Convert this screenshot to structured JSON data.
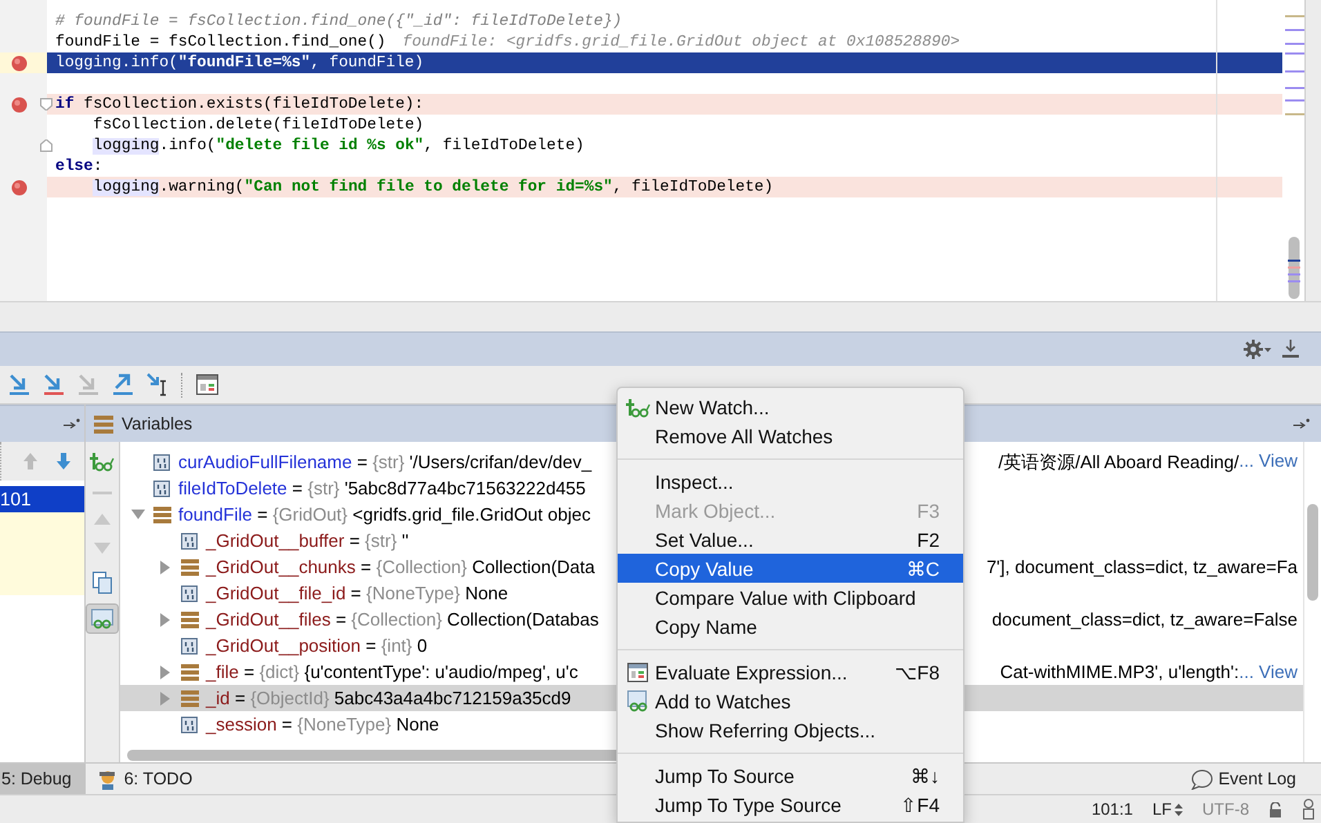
{
  "editor": {
    "lines": [
      {
        "current": false,
        "breakpoint": false,
        "fold_start": false,
        "fold_end": false,
        "tokens": [
          {
            "kind": "comment",
            "text": "# foundFile = fsCollection.find_one({\"_id\": fileIdToDelete})"
          }
        ]
      },
      {
        "current": false,
        "breakpoint": false,
        "fold_start": false,
        "fold_end": false,
        "tokens": [
          {
            "kind": "plain",
            "text": "foundFile = fsCollection.find_one()"
          }
        ],
        "hint": "foundFile: <gridfs.grid_file.GridOut object at 0x108528890>"
      },
      {
        "current": true,
        "breakpoint": true,
        "fold_start": false,
        "fold_end": false,
        "tokens": [
          {
            "kind": "plain",
            "text": "logging.info("
          },
          {
            "kind": "string",
            "text": "\"foundFile=%s\""
          },
          {
            "kind": "plain",
            "text": ", foundFile)"
          }
        ]
      },
      {
        "current": false,
        "breakpoint": true,
        "fold_start": true,
        "fold_end": false,
        "tokens": [
          {
            "kind": "keyword",
            "text": "if"
          },
          {
            "kind": "plain",
            "text": " fsCollection.exists(fileIdToDelete):"
          }
        ],
        "children": [
          {
            "current": false,
            "breakpoint": false,
            "fold_start": false,
            "fold_end": false,
            "tokens": [
              {
                "kind": "plain",
                "text": "fsCollection.delete(fileIdToDelete)"
              }
            ]
          },
          {
            "current": false,
            "breakpoint": false,
            "fold_start": false,
            "fold_end": true,
            "tokens": [
              {
                "kind": "ref",
                "text": "logging"
              },
              {
                "kind": "plain",
                "text": ".info("
              },
              {
                "kind": "string",
                "text": "\"delete file id %s ok\""
              },
              {
                "kind": "plain",
                "text": ", fileIdToDelete)"
              }
            ]
          }
        ]
      },
      {
        "current": false,
        "breakpoint": false,
        "fold_start": false,
        "fold_end": false,
        "tokens": [
          {
            "kind": "keyword",
            "text": "else"
          },
          {
            "kind": "plain",
            "text": ":"
          }
        ],
        "children": [
          {
            "current": false,
            "breakpoint": true,
            "fold_start": false,
            "fold_end": false,
            "tokens": [
              {
                "kind": "ref",
                "text": "logging"
              },
              {
                "kind": "plain",
                "text": ".warning("
              },
              {
                "kind": "string",
                "text": "\"Can not find file to delete for id=%s\""
              },
              {
                "kind": "plain",
                "text": ", fileIdToDelete)"
              }
            ]
          }
        ]
      }
    ]
  },
  "debug_toolbar": {
    "buttons": [
      {
        "disabled": false
      },
      {
        "disabled": false
      },
      {
        "disabled": true
      },
      {
        "disabled": false
      },
      {
        "disabled": false
      },
      {
        "disabled": false
      }
    ]
  },
  "frames": {
    "rows": [
      {
        "label": "101",
        "selected": true
      }
    ]
  },
  "variables": {
    "title": "Variables",
    "rows": [
      {
        "kind": "primitive",
        "name": "curAudioFullFilename",
        "operator": "=",
        "type": "{str}",
        "value": "'/Users/crifan/dev/dev_",
        "value_right": "/英语资源/All Aboard Reading/",
        "link": "... View",
        "expandable": false,
        "selected": false
      },
      {
        "kind": "primitive",
        "name": "fileIdToDelete",
        "operator": "=",
        "type": "{str}",
        "value": "'5abc8d77a4bc71563222d455",
        "expandable": false,
        "selected": false
      },
      {
        "kind": "object",
        "name": "foundFile",
        "operator": "=",
        "type": "{GridOut}",
        "value": "<gridfs.grid_file.GridOut objec",
        "expandable": true,
        "expanded": true,
        "selected": false,
        "children": [
          {
            "kind": "primitive",
            "name": "_GridOut__buffer",
            "operator": "=",
            "type": "{str}",
            "value": "''",
            "expandable": false,
            "selected": false
          },
          {
            "kind": "object",
            "name": "_GridOut__chunks",
            "operator": "=",
            "type": "{Collection}",
            "value": "Collection(Data",
            "value_right": "7'], document_class=dict, tz_aware=Fa",
            "expandable": true,
            "expanded": false,
            "selected": false
          },
          {
            "kind": "primitive",
            "name": "_GridOut__file_id",
            "operator": "=",
            "type": "{NoneType}",
            "value": "None",
            "expandable": false,
            "selected": false
          },
          {
            "kind": "object",
            "name": "_GridOut__files",
            "operator": "=",
            "type": "{Collection}",
            "value": "Collection(Databas",
            "value_right": "document_class=dict, tz_aware=False",
            "expandable": true,
            "expanded": false,
            "selected": false
          },
          {
            "kind": "primitive",
            "name": "_GridOut__position",
            "operator": "=",
            "type": "{int}",
            "value": "0",
            "expandable": false,
            "selected": false
          },
          {
            "kind": "object",
            "name": "_file",
            "operator": "=",
            "type": "{dict}",
            "value": "{u'contentType': u'audio/mpeg', u'c",
            "value_right": "Cat-withMIME.MP3', u'length':",
            "link": "... View",
            "expandable": true,
            "expanded": false,
            "selected": false
          },
          {
            "kind": "object",
            "name": "_id",
            "operator": "=",
            "type": "{ObjectId}",
            "value": "5abc43a4a4bc712159a35cd9",
            "expandable": true,
            "expanded": false,
            "selected": true
          },
          {
            "kind": "primitive",
            "name": "_session",
            "operator": "=",
            "type": "{NoneType}",
            "value": "None",
            "expandable": false,
            "selected": false
          }
        ]
      }
    ]
  },
  "context_menu": {
    "items": [
      {
        "kind": "item",
        "label": "New Watch...",
        "disabled": false,
        "selected": false
      },
      {
        "kind": "item",
        "label": "Remove All Watches",
        "disabled": false,
        "selected": false
      },
      {
        "kind": "separator"
      },
      {
        "kind": "item",
        "label": "Inspect...",
        "disabled": false,
        "selected": false
      },
      {
        "kind": "item",
        "label": "Mark Object...",
        "shortcut": "F3",
        "disabled": true,
        "selected": false
      },
      {
        "kind": "item",
        "label": "Set Value...",
        "shortcut": "F2",
        "disabled": false,
        "selected": false
      },
      {
        "kind": "item",
        "label": "Copy Value",
        "shortcut": "⌘C",
        "disabled": false,
        "selected": true
      },
      {
        "kind": "item",
        "label": "Compare Value with Clipboard",
        "disabled": false,
        "selected": false
      },
      {
        "kind": "item",
        "label": "Copy Name",
        "disabled": false,
        "selected": false
      },
      {
        "kind": "separator"
      },
      {
        "kind": "item",
        "label": "Evaluate Expression...",
        "shortcut": "⌥F8",
        "disabled": false,
        "selected": false
      },
      {
        "kind": "item",
        "label": "Add to Watches",
        "disabled": false,
        "selected": false
      },
      {
        "kind": "item",
        "label": "Show Referring Objects...",
        "disabled": false,
        "selected": false
      },
      {
        "kind": "separator"
      },
      {
        "kind": "item",
        "label": "Jump To Source",
        "shortcut": "⌘↓",
        "disabled": false,
        "selected": false
      },
      {
        "kind": "item",
        "label": "Jump To Type Source",
        "shortcut": "⇧F4",
        "disabled": false,
        "selected": false
      }
    ]
  },
  "tool_window_bar": {
    "tabs": [
      {
        "label": "5: Debug",
        "selected": true
      },
      {
        "label": "6: TODO",
        "selected": false
      }
    ],
    "event_log": "Event Log"
  },
  "status_bar": {
    "position": "101:1",
    "line_separator": "LF",
    "encoding": "UTF-8"
  }
}
